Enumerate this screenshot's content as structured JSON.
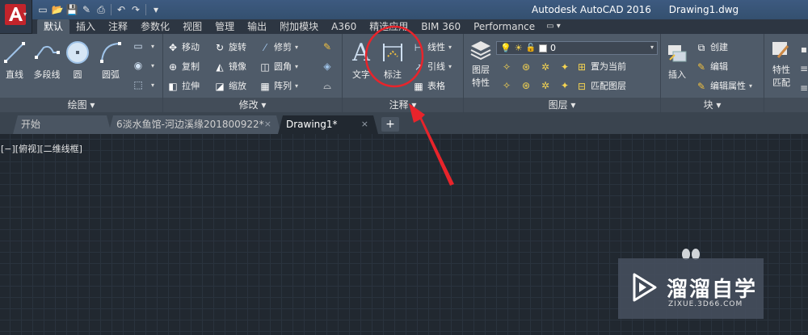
{
  "title": {
    "app": "Autodesk AutoCAD 2016",
    "document": "Drawing1.dwg"
  },
  "qat": {
    "icons": [
      "new-icon",
      "open-icon",
      "save-icon",
      "save-as-icon",
      "print-icon",
      "undo-icon",
      "redo-icon",
      "customize-icon"
    ]
  },
  "ribbon_tabs": [
    "默认",
    "插入",
    "注释",
    "参数化",
    "视图",
    "管理",
    "输出",
    "附加模块",
    "A360",
    "精选应用",
    "BIM 360",
    "Performance"
  ],
  "ribbon_extra": "▭ ▾",
  "panels": {
    "draw": {
      "title": "绘图",
      "line": "直线",
      "polyline": "多段线",
      "circle": "圆",
      "arc": "圆弧"
    },
    "modify": {
      "title": "修改",
      "move": "移动",
      "rotate": "旋转",
      "trim": "修剪",
      "copy": "复制",
      "mirror": "镜像",
      "fillet": "圆角",
      "stretch": "拉伸",
      "scale": "缩放",
      "array": "阵列"
    },
    "annotation": {
      "title": "注释",
      "text": "文字",
      "dimension": "标注",
      "linear": "线性",
      "leader": "引线",
      "table": "表格"
    },
    "layers": {
      "title": "图层",
      "properties_line1": "图层",
      "properties_line2": "特性",
      "current_layer": "0",
      "make_current": "置为当前",
      "match_layer": "匹配图层"
    },
    "block": {
      "title": "块",
      "insert": "插入",
      "create": "创建",
      "edit": "编辑",
      "edit_attributes": "编辑属性"
    },
    "properties": {
      "match_line1": "特性",
      "match_line2": "匹配"
    }
  },
  "doc_tabs": {
    "start": "开始",
    "tab1": "6淡水鱼馆-河边溪缘201800922*",
    "tab2": "Drawing1*",
    "close": "×",
    "new": "+"
  },
  "viewport_label": "[−][俯视][二维线框]",
  "watermark": {
    "name": "溜溜自学",
    "url": "ZIXUE.3D66.COM"
  },
  "colors": {
    "titlebar": "#3d5a80",
    "ribbon": "#4f5b69",
    "canvas": "#212830",
    "annotation": "#e8242b",
    "grid": "#2a333e"
  }
}
